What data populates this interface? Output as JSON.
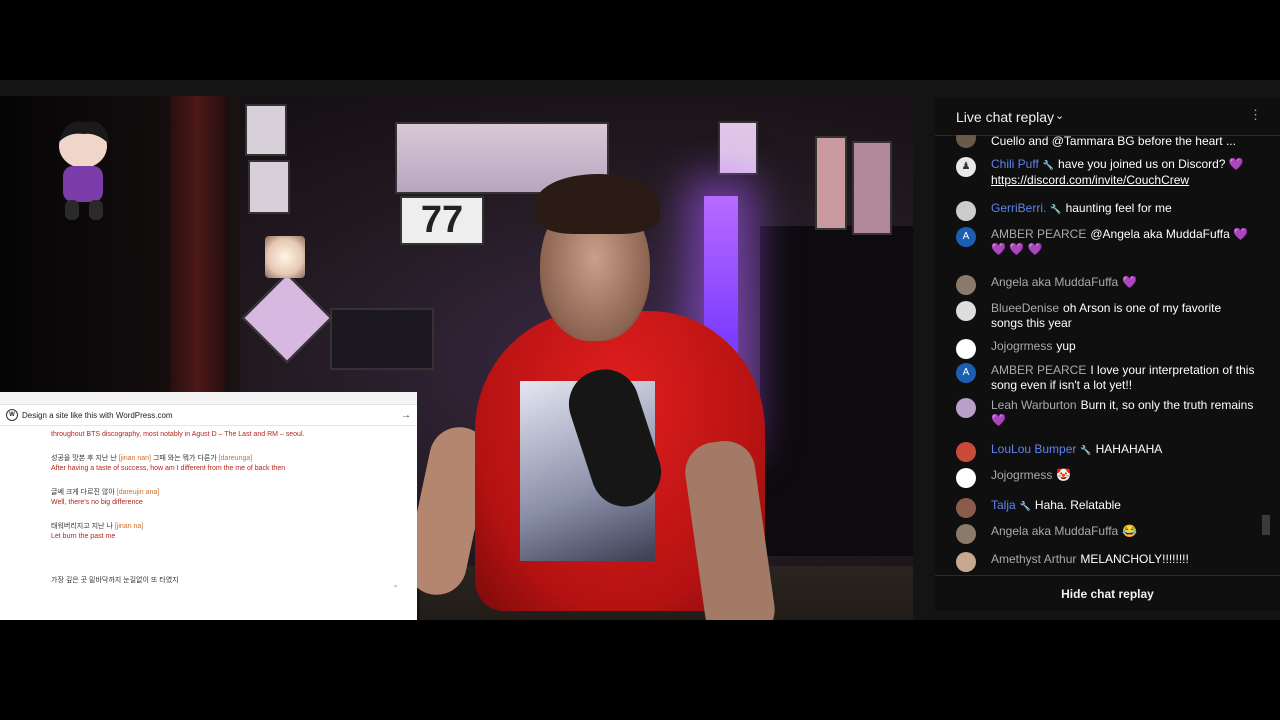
{
  "chat": {
    "title": "Live chat replay",
    "footer_button": "Hide chat replay",
    "messages": [
      {
        "author": "",
        "text": "Cuello and @Tammara BG before the heart ...",
        "avatar": "",
        "mod": false
      },
      {
        "author": "Chili Puff",
        "text": "have you joined us on Discord? 💜",
        "link": "https://discord.com/invite/CouchCrew",
        "avatar": "",
        "mod": true
      },
      {
        "author": "GerriBerri.",
        "text": "haunting feel for me",
        "avatar": "",
        "mod": true
      },
      {
        "author": "AMBER PEARCE",
        "text": "@Angela aka MuddaFuffa 💜",
        "text2": "💜 💜 💜",
        "avatar": "A",
        "mod": false
      },
      {
        "author": "Angela aka MuddaFuffa",
        "text": "💜",
        "avatar": "",
        "mod": false
      },
      {
        "author": "BlueeDenise",
        "text": "oh Arson is one of my favorite songs this year",
        "avatar": "",
        "mod": false
      },
      {
        "author": "Jojogrmess",
        "text": "yup",
        "avatar": "",
        "mod": false
      },
      {
        "author": "AMBER PEARCE",
        "text": "I love your interpretation of this song even if isn't a lot yet!!",
        "avatar": "A",
        "mod": false
      },
      {
        "author": "Leah Warburton",
        "text": "Burn it, so only the truth remains 💜",
        "avatar": "",
        "mod": false
      },
      {
        "author": "LouLou Bumper",
        "text": "HAHAHAHA",
        "avatar": "",
        "mod": true
      },
      {
        "author": "Jojogrmess",
        "text": "🤡",
        "avatar": "",
        "mod": false
      },
      {
        "author": "Talja",
        "text": "Haha. Relatable",
        "avatar": "",
        "mod": true
      },
      {
        "author": "Angela aka MuddaFuffa",
        "text": "😂",
        "avatar": "",
        "mod": false
      },
      {
        "author": "Amethyst Arthur",
        "text": "MELANCHOLY!!!!!!!!",
        "avatar": "",
        "mod": false
      }
    ]
  },
  "wp": {
    "banner": "Design a site like this with WordPress.com",
    "intro": "throughout BTS discography, most notably in Agust D – The Last and RM – seoul.",
    "lyrics": [
      {
        "ko": "성공을 맛본 후 지난 난",
        "rom": "[jinan nan]",
        "ko2": "그때 와는 뭐가 다른가",
        "rom2": "[dareunga]",
        "en": "After having a taste of success, how am I different from the me of back then"
      },
      {
        "ko": "글쎄 크게 다르진 않아",
        "rom": "[dareujin ana]",
        "en": "Well, there's no big difference"
      },
      {
        "ko": "태워버리지고 지난 나",
        "rom": "[jinan na]",
        "en": "Let burn the past me"
      }
    ],
    "bottom_line": "가장 깊은 곳 밑바닥까지 눈길없이 또 타였지"
  },
  "video": {
    "clock_digits": "77"
  }
}
